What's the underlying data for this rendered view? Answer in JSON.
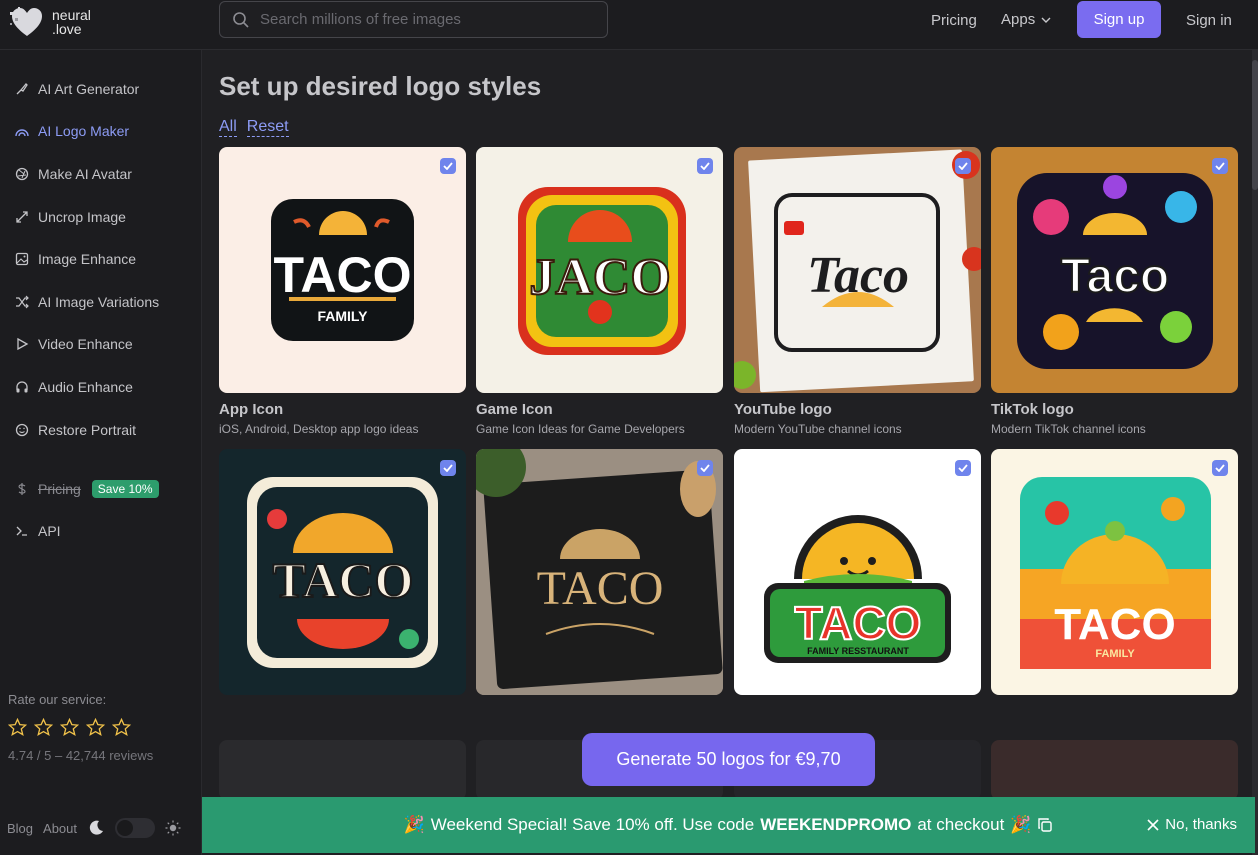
{
  "brand": {
    "name_line1": "neural",
    "name_line2": ".love"
  },
  "search": {
    "placeholder": "Search millions of free images"
  },
  "nav": {
    "pricing": "Pricing",
    "apps": "Apps",
    "signup": "Sign up",
    "signin": "Sign in"
  },
  "sidebar": {
    "items": [
      {
        "label": "AI Art Generator",
        "icon": "brush-icon"
      },
      {
        "label": "AI Logo Maker",
        "icon": "rainbow-icon",
        "active": true
      },
      {
        "label": "Make AI Avatar",
        "icon": "aperture-icon"
      },
      {
        "label": "Uncrop Image",
        "icon": "expand-icon"
      },
      {
        "label": "Image Enhance",
        "icon": "image-icon"
      },
      {
        "label": "AI Image Variations",
        "icon": "shuffle-icon"
      },
      {
        "label": "Video Enhance",
        "icon": "play-icon"
      },
      {
        "label": "Audio Enhance",
        "icon": "headphones-icon"
      },
      {
        "label": "Restore Portrait",
        "icon": "smile-icon"
      }
    ],
    "pricing_label": "Pricing",
    "pricing_badge": "Save 10%",
    "api_label": "API",
    "rate_label": "Rate our service:",
    "rating_text": "4.74 / 5 – 42,744 reviews",
    "footer": {
      "blog": "Blog",
      "about": "About"
    }
  },
  "main": {
    "title": "Set up desired logo styles",
    "filter_all": "All",
    "filter_reset": "Reset",
    "cards": [
      {
        "title": "App Icon",
        "desc": "iOS, Android, Desktop app logo ideas",
        "word": "TACO",
        "sub": "FAMILY"
      },
      {
        "title": "Game Icon",
        "desc": "Game Icon Ideas for Game Developers",
        "word": "JACO",
        "sub": ""
      },
      {
        "title": "YouTube logo",
        "desc": "Modern YouTube channel icons",
        "word": "Taco",
        "sub": ""
      },
      {
        "title": "TikTok logo",
        "desc": "Modern TikTok channel icons",
        "word": "Taco",
        "sub": ""
      },
      {
        "title": "",
        "desc": "",
        "word": "TACO",
        "sub": ""
      },
      {
        "title": "",
        "desc": "",
        "word": "TACO",
        "sub": ""
      },
      {
        "title": "",
        "desc": "",
        "word": "TACO",
        "sub": "FAMILY RESSTAURANT"
      },
      {
        "title": "",
        "desc": "",
        "word": "TACO",
        "sub": "FAMILY"
      }
    ],
    "generate_label": "Generate 50 logos for €9,70"
  },
  "promo": {
    "text_before": "Weekend Special! Save 10% off. Use code",
    "code": "WEEKENDPROMO",
    "text_after": "at checkout",
    "dismiss": "No, thanks"
  },
  "colors": {
    "accent": "#7a6cf0",
    "promo": "#2a9a70",
    "link": "#8d9cf5"
  }
}
